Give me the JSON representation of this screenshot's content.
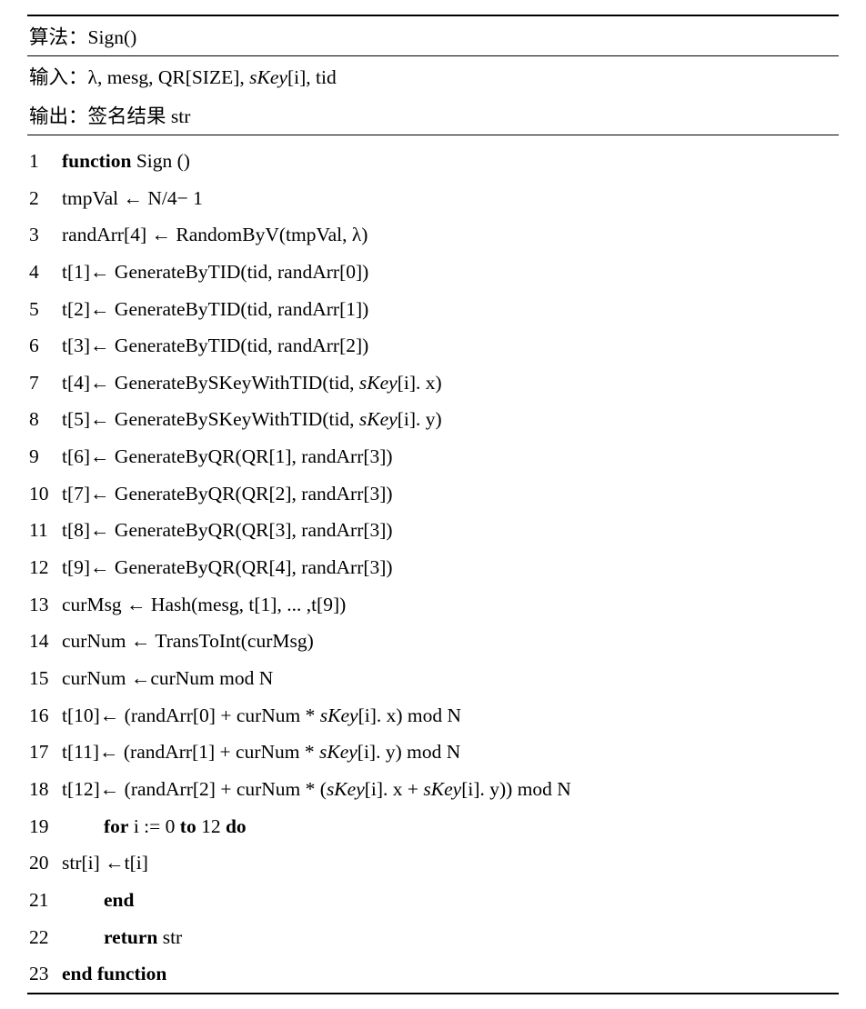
{
  "header": {
    "algo_label": "算法：",
    "algo_name": "Sign()",
    "input_label": "输入：",
    "input_value_prefix": "λ, mesg, QR[SIZE],  ",
    "input_skey": "sKey",
    "input_value_suffix": "[i],  tid",
    "output_label": "输出：",
    "output_value": "签名结果 str"
  },
  "lines": {
    "l1_kw": "function",
    "l1_rest": " Sign ()",
    "l2": "tmpVal  ←  N/4− 1",
    "l3": "randArr[4]  ←  RandomByV(tmpVal, λ)",
    "l4": "t[1]←  GenerateByTID(tid, randArr[0])",
    "l5": "t[2]←  GenerateByTID(tid, randArr[1])",
    "l6": "t[3]←  GenerateByTID(tid, randArr[2])",
    "l7_a": "t[4]←  GenerateBySKeyWithTID(tid,  ",
    "l7_sk": "sKey",
    "l7_b": "[i]. x)",
    "l8_a": "t[5]←  GenerateBySKeyWithTID(tid,  ",
    "l8_sk": "sKey",
    "l8_b": "[i]. y)",
    "l9": "t[6]←  GenerateByQR(QR[1], randArr[3])",
    "l10": "t[7]←  GenerateByQR(QR[2], randArr[3])",
    "l11": "t[8]←  GenerateByQR(QR[3], randArr[3])",
    "l12": "t[9]←  GenerateByQR(QR[4], randArr[3])",
    "l13": "curMsg  ←  Hash(mesg, t[1], ... ,t[9])",
    "l14": "curNum  ←  TransToInt(curMsg)",
    "l15": "curNum  ←curNum mod N",
    "l16_a": "t[10]←  (randArr[0] + curNum *  ",
    "l16_sk": "sKey",
    "l16_b": "[i]. x) mod N",
    "l17_a": "t[11]←  (randArr[1] + curNum *  ",
    "l17_sk": "sKey",
    "l17_b": "[i]. y) mod N",
    "l18_a": "t[12]←  (randArr[2] + curNum *  (",
    "l18_sk1": "sKey",
    "l18_mid": "[i]. x + ",
    "l18_sk2": "sKey",
    "l18_b": "[i]. y)) mod N",
    "l19_kw1": "for",
    "l19_mid": " i := 0 ",
    "l19_kw2": "to",
    "l19_mid2": " 12 ",
    "l19_kw3": "do",
    "l20": "str[i]  ←t[i]",
    "l21_kw": "end",
    "l22_kw": "return",
    "l22_rest": " str",
    "l23_kw": "end function"
  },
  "numbers": {
    "n1": "1",
    "n2": "2",
    "n3": "3",
    "n4": "4",
    "n5": "5",
    "n6": "6",
    "n7": "7",
    "n8": "8",
    "n9": "9",
    "n10": "10",
    "n11": "11",
    "n12": "12",
    "n13": "13",
    "n14": "14",
    "n15": "15",
    "n16": "16",
    "n17": "17",
    "n18": "18",
    "n19": "19",
    "n20": "20",
    "n21": "21",
    "n22": "22",
    "n23": "23"
  }
}
